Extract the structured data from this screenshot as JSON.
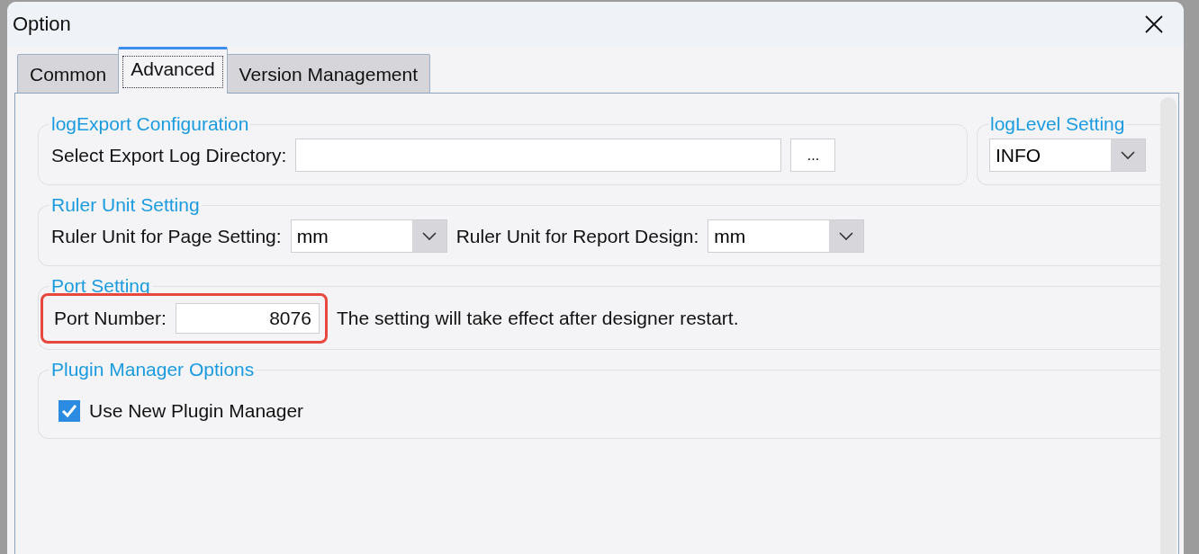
{
  "window": {
    "title": "Option"
  },
  "tabs": [
    {
      "label": "Common",
      "selected": false
    },
    {
      "label": "Advanced",
      "selected": true
    },
    {
      "label": "Version Management",
      "selected": false
    }
  ],
  "log_export": {
    "title": "logExport Configuration",
    "label": "Select Export Log Directory:",
    "browse_button": "..."
  },
  "log_level": {
    "title": "logLevel Setting",
    "value": "INFO"
  },
  "ruler_unit": {
    "title": "Ruler Unit Setting",
    "fields": [
      {
        "label": "Ruler Unit for Page Setting:",
        "value": "mm"
      },
      {
        "label": "Ruler Unit for Report Design:",
        "value": "mm"
      }
    ]
  },
  "port": {
    "title": "Port Setting",
    "label": "Port Number:",
    "value": "8076",
    "note": "The setting will take effect after designer restart.",
    "highlighted": true
  },
  "plugin": {
    "title": "Plugin Manager Options",
    "checkbox": {
      "label": "Use New Plugin Manager",
      "checked": true
    }
  }
}
